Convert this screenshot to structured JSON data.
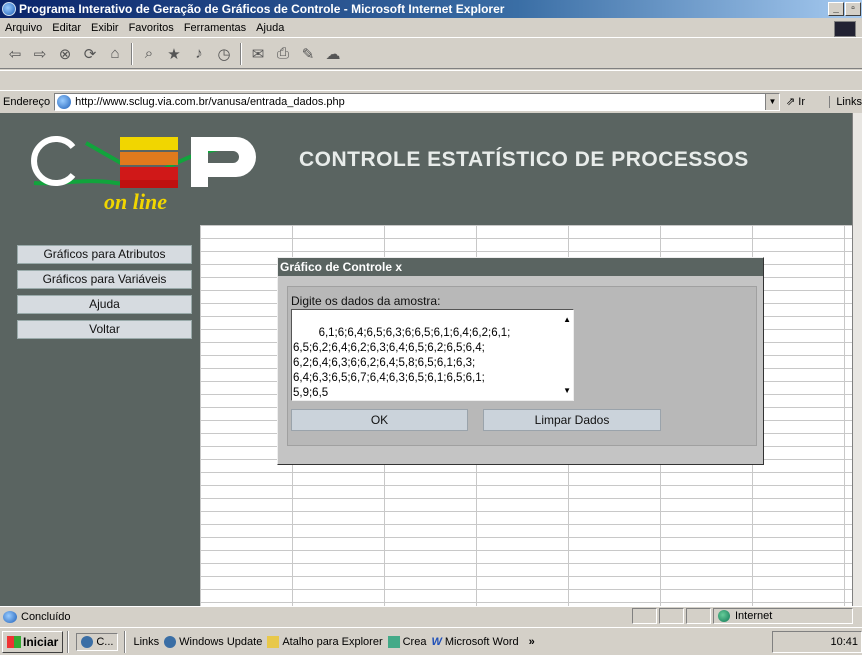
{
  "window": {
    "title": "Programa Interativo de Geração de Gráficos de Controle - Microsoft Internet Explorer",
    "btn_min": "_",
    "btn_max": "▫"
  },
  "menu": [
    "Arquivo",
    "Editar",
    "Exibir",
    "Favoritos",
    "Ferramentas",
    "Ajuda"
  ],
  "address": {
    "label": "Endereço",
    "url": "http://www.sclug.via.com.br/vanusa/entrada_dados.php",
    "go": "Ir",
    "links": "Links"
  },
  "colors": {
    "header_bg": "#5a6461",
    "title_fg": "#e8ecea",
    "logo_yellow": "#f1d600",
    "logo_orange": "#e07a1d",
    "logo_red": "#d01818",
    "logo_green": "#11a43c"
  },
  "site": {
    "logo_text": "on line",
    "title": "CONTROLE ESTATÍSTICO DE PROCESSOS"
  },
  "nav": [
    "Gráficos para Atributos",
    "Gráficos para Variáveis",
    "Ajuda",
    "Voltar"
  ],
  "dialog": {
    "title": "Gráfico de Controle x",
    "label": "Digite os dados da amostra:",
    "data": "6,1;6;6,4;6,5;6,3;6;6,5;6,1;6,4;6,2;6,1;\n6,5;6,2;6,4;6,2;6,3;6,4;6,5;6,2;6,5;6,4;\n6,2;6,4;6,3;6;6,2;6,4;5,8;6,5;6,1;6,3;\n6,4;6,3;6,5;6,7;6,4;6,3;6,5;6,1;6,5;6,1;\n5,9;6,5",
    "ok": "OK",
    "clear": "Limpar Dados"
  },
  "status": {
    "text": "Concluído",
    "zone": "Internet"
  },
  "taskbar": {
    "start": "Iniciar",
    "task1": "C...",
    "links": "Links",
    "q1": "Windows Update",
    "q2": "Atalho para Explorer",
    "q3": "Crea",
    "q4": "Microsoft Word",
    "clock": "10:41"
  }
}
